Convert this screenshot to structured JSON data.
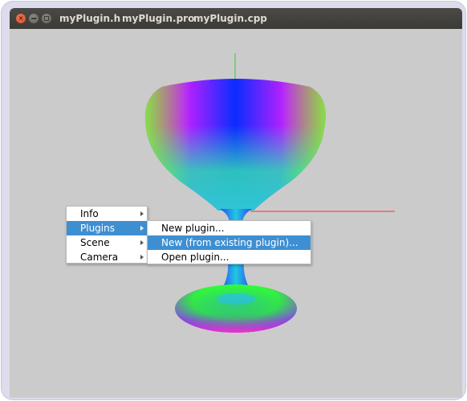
{
  "window": {
    "tabs": [
      {
        "label": "myPlugin.h"
      },
      {
        "label": "myPlugin.pro"
      },
      {
        "label": "myPlugin.cpp"
      }
    ]
  },
  "context_menu": {
    "items": [
      {
        "label": "Info",
        "has_submenu": true
      },
      {
        "label": "Plugins",
        "has_submenu": true,
        "selected": true
      },
      {
        "label": "Scene",
        "has_submenu": true
      },
      {
        "label": "Camera",
        "has_submenu": true
      }
    ]
  },
  "plugins_submenu": {
    "items": [
      {
        "label": "New plugin..."
      },
      {
        "label": "New (from existing plugin)...",
        "selected": true
      },
      {
        "label": "Open plugin..."
      }
    ]
  },
  "colors": {
    "selection": "#3e8fd2",
    "viewport_bg": "#cbcbcb",
    "axis_x": "#ff3030",
    "axis_y": "#30d030"
  }
}
